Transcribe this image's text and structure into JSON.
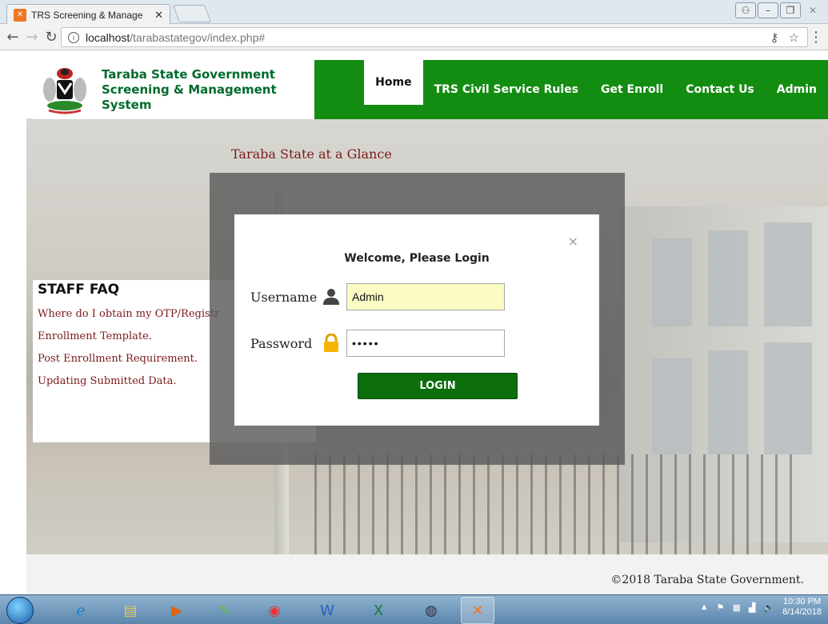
{
  "browser": {
    "tab_title": "TRS Screening & Manage",
    "tab_close": "✕",
    "url_host": "localhost",
    "url_path": "/tarabastategov/index.php#"
  },
  "header": {
    "brand_line1": "Taraba State Government",
    "brand_line2": "Screening & Management System",
    "nav": [
      "Home",
      "TRS Civil Service Rules",
      "Get Enroll",
      "Contact Us",
      "Admin"
    ]
  },
  "main": {
    "glance": "Taraba State at a Glance"
  },
  "faq": {
    "title": "STAFF FAQ",
    "items": [
      "Where do I obtain my OTP/Registr",
      "Enrollment Template.",
      "Post Enrollment Requirement.",
      "Updating Submitted Data."
    ]
  },
  "login": {
    "title": "Welcome, Please Login",
    "close": "×",
    "username_label": "Username",
    "username_value": "Admin",
    "password_label": "Password",
    "password_value": "•••••",
    "button": "LOGIN"
  },
  "footer": {
    "copyright": "©2018 Taraba State Government."
  },
  "taskbar": {
    "time": "10:30 PM",
    "date": "8/14/2018"
  },
  "colors": {
    "nav_green": "#138c12",
    "brand_green": "#006b2d",
    "button_green": "#0b6e0b",
    "faq_red": "#7b1b1b"
  }
}
